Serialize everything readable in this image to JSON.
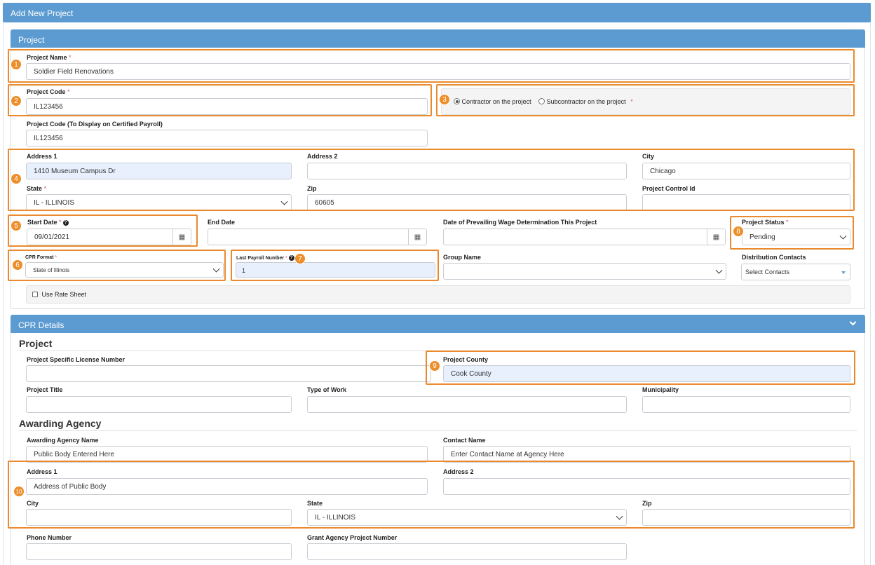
{
  "header": {
    "title": "Add New Project"
  },
  "project_panel": {
    "title": "Project",
    "project_name": {
      "label": "Project Name",
      "value": "Soldier Field Renovations"
    },
    "project_code": {
      "label": "Project Code",
      "value": "IL123456"
    },
    "role": {
      "contractor_label": "Contractor on the project",
      "subcontractor_label": "Subcontractor on the project",
      "selected": "contractor"
    },
    "project_code_display": {
      "label": "Project Code (To Display on Certified Payroll)",
      "value": "IL123456"
    },
    "address1": {
      "label": "Address 1",
      "value": "1410 Museum Campus Dr"
    },
    "address2": {
      "label": "Address 2",
      "value": ""
    },
    "city": {
      "label": "City",
      "value": "Chicago"
    },
    "state": {
      "label": "State",
      "value": "IL - ILLINOIS"
    },
    "zip": {
      "label": "Zip",
      "value": "60605"
    },
    "project_control_id": {
      "label": "Project Control Id",
      "value": ""
    },
    "start_date": {
      "label": "Start Date",
      "value": "09/01/2021"
    },
    "end_date": {
      "label": "End Date",
      "value": ""
    },
    "prevailing_wage_date": {
      "label": "Date of Prevailing Wage Determination This Project",
      "value": ""
    },
    "project_status": {
      "label": "Project Status",
      "value": "Pending"
    },
    "cpr_format": {
      "label": "CPR Format",
      "value": "State of Illinois"
    },
    "last_payroll_number": {
      "label": "Last Payroll Number",
      "value": "1"
    },
    "group_name": {
      "label": "Group Name",
      "value": ""
    },
    "distribution_contacts": {
      "label": "Distribution Contacts",
      "value": "Select Contacts"
    },
    "use_rate_sheet": {
      "label": "Use Rate Sheet",
      "checked": false
    }
  },
  "cpr_panel": {
    "title": "CPR Details",
    "project_section": {
      "heading": "Project",
      "license_number": {
        "label": "Project Specific License Number",
        "value": ""
      },
      "county": {
        "label": "Project County",
        "value": "Cook County"
      },
      "title": {
        "label": "Project Title",
        "value": ""
      },
      "type_of_work": {
        "label": "Type of Work",
        "value": ""
      },
      "municipality": {
        "label": "Municipality",
        "value": ""
      }
    },
    "agency_section": {
      "heading": "Awarding Agency",
      "agency_name": {
        "label": "Awarding Agency Name",
        "placeholder": "Public Body Entered Here"
      },
      "contact_name": {
        "label": "Contact Name",
        "placeholder": "Enter Contact Name at Agency Here"
      },
      "address1": {
        "label": "Address 1",
        "placeholder": "Address of Public Body"
      },
      "address2": {
        "label": "Address 2",
        "value": ""
      },
      "city": {
        "label": "City",
        "value": ""
      },
      "state": {
        "label": "State",
        "value": "IL - ILLINOIS"
      },
      "zip": {
        "label": "Zip",
        "value": ""
      },
      "phone": {
        "label": "Phone Number",
        "value": ""
      },
      "grant_project_number": {
        "label": "Grant Agency Project Number",
        "value": ""
      }
    }
  },
  "required_marker": "*",
  "callouts": [
    "1",
    "2",
    "3",
    "4",
    "5",
    "6",
    "7",
    "8",
    "9",
    "10"
  ],
  "icons": {
    "calendar": "calendar-icon",
    "help": "question-circle-icon",
    "chevron": "chevron-down-icon"
  },
  "colors": {
    "header_blue": "#5b9bd1",
    "highlight_orange": "#ea8a2e",
    "autofill_blue": "#e8f0fe"
  }
}
